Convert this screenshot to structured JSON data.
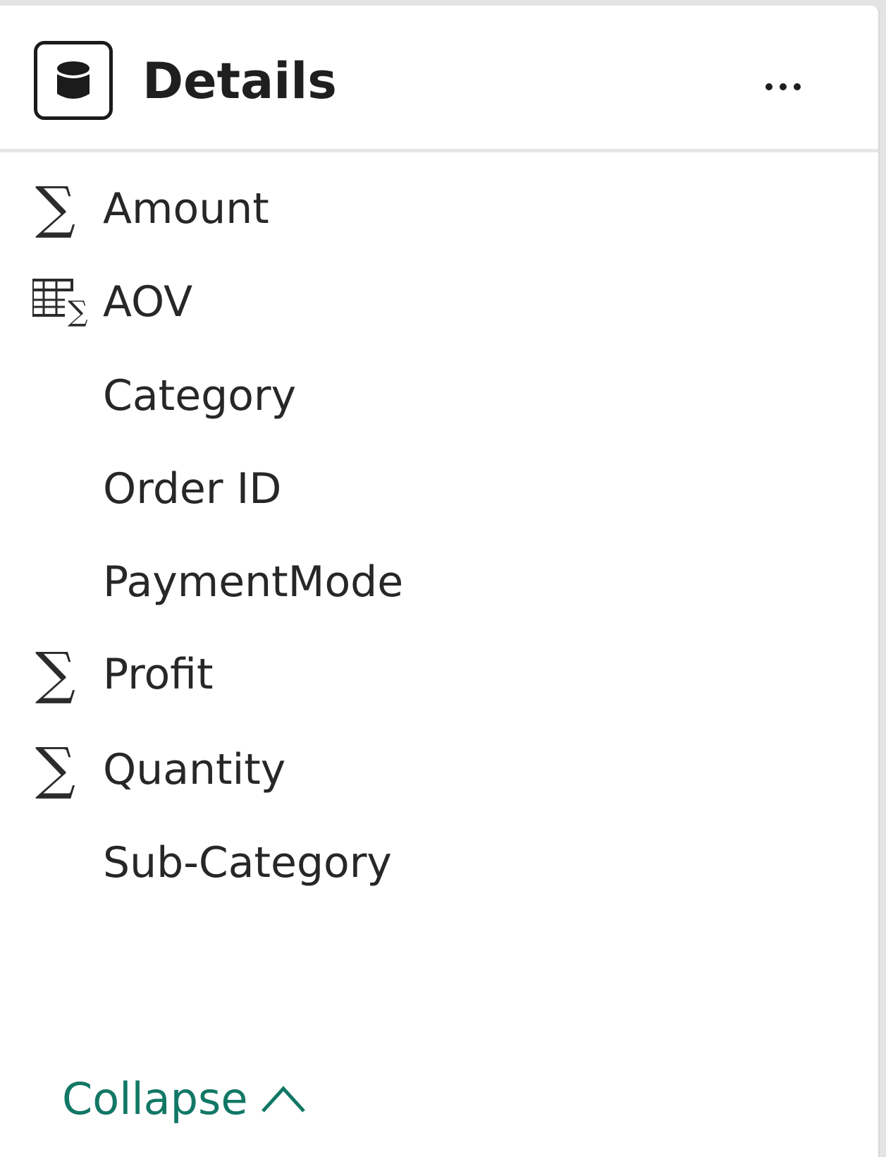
{
  "panel": {
    "title": "Details",
    "title_icon": "database-icon",
    "more_icon": "more-options-icon"
  },
  "fields": [
    {
      "label": "Amount",
      "icon": "sigma-icon"
    },
    {
      "label": "AOV",
      "icon": "measure-table-icon"
    },
    {
      "label": "Category",
      "icon": ""
    },
    {
      "label": "Order ID",
      "icon": ""
    },
    {
      "label": "PaymentMode",
      "icon": ""
    },
    {
      "label": "Profit",
      "icon": "sigma-icon"
    },
    {
      "label": "Quantity",
      "icon": "sigma-icon"
    },
    {
      "label": "Sub-Category",
      "icon": ""
    }
  ],
  "collapse": {
    "label": "Collapse",
    "icon": "chevron-up-icon"
  },
  "colors": {
    "accent": "#117865",
    "text": "#272727"
  }
}
